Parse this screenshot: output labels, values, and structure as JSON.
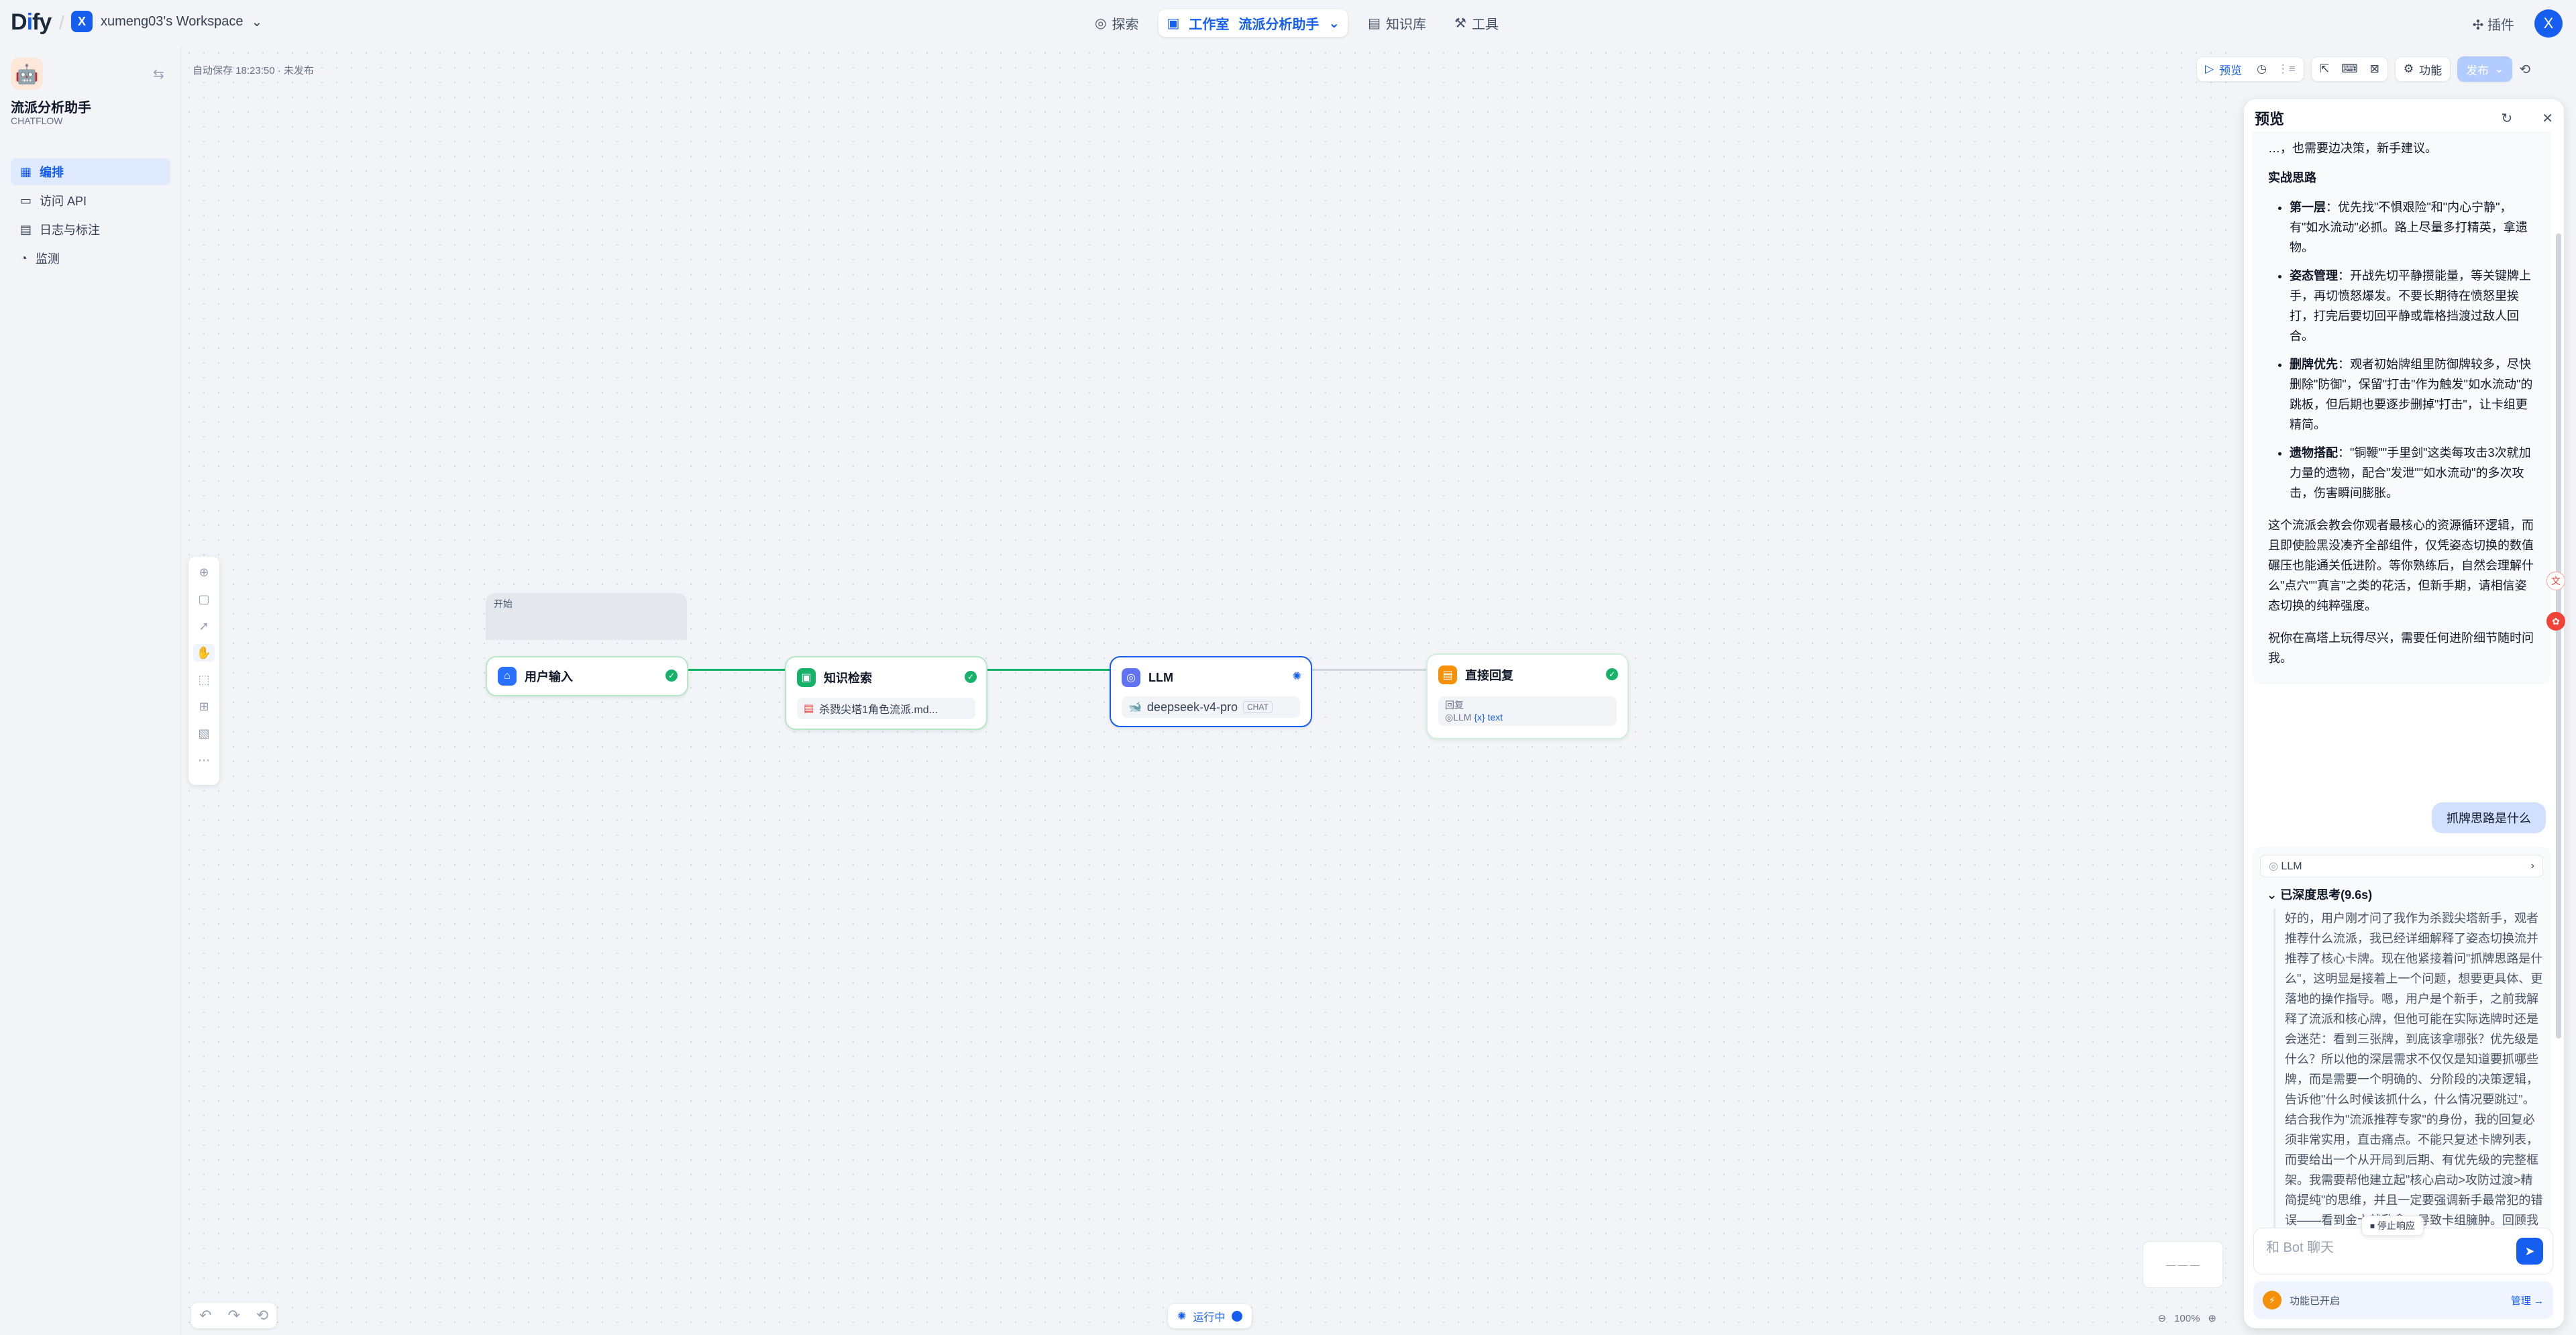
{
  "topbar": {
    "logo": "Dify",
    "workspace_initial": "X",
    "workspace_name": "xumeng03's Workspace",
    "nav": [
      "探索",
      "工作室",
      "流派分析助手",
      "知识库",
      "工具"
    ],
    "plugins": "插件",
    "user_initial": "X"
  },
  "sidebar": {
    "app_name": "流派分析助手",
    "app_type": "CHATFLOW",
    "items": [
      "编排",
      "访问 API",
      "日志与标注",
      "监测"
    ]
  },
  "canvas": {
    "autosave": "自动保存 18:23:50 · 未发布",
    "buttons": {
      "preview": "预览",
      "features": "功能",
      "publish": "发布"
    },
    "status_pill": "运行中",
    "zoom": "100%"
  },
  "nodes": {
    "start_tag": "开始",
    "user_input": "用户输入",
    "knowledge": "知识检索",
    "knowledge_file": "杀戮尖塔1角色流派.md...",
    "llm": "LLM",
    "llm_model": "deepseek-v4-pro",
    "llm_mode": "CHAT",
    "reply": "直接回复",
    "reply_label": "回复",
    "reply_var_node": "LLM",
    "reply_var": "{x} text"
  },
  "preview": {
    "title": "预览",
    "bot_answer": {
      "top_cut": "…，也需要边决策，新手建议。",
      "heading": "实战思路",
      "items": [
        {
          "b": "第一层",
          "t": "：优先找\"不惧艰险\"和\"内心宁静\"，有\"如水流动\"必抓。路上尽量多打精英，拿遗物。"
        },
        {
          "b": "姿态管理",
          "t": "：开战先切平静攒能量，等关键牌上手，再切愤怒爆发。不要长期待在愤怒里挨打，打完后要切回平静或靠格挡渡过敌人回合。"
        },
        {
          "b": "删牌优先",
          "t": "：观者初始牌组里防御牌较多，尽快删除\"防御\"，保留\"打击\"作为触发\"如水流动\"的跳板，但后期也要逐步删掉\"打击\"，让卡组更精简。"
        },
        {
          "b": "遗物搭配",
          "t": "：\"铜鞭\"\"手里剑\"这类每攻击3次就加力量的遗物，配合\"发泄\"\"如水流动\"的多次攻击，伤害瞬间膨胀。"
        }
      ],
      "para1": "这个流派会教会你观者最核心的资源循环逻辑，而且即使脸黑没凑齐全部组件，仅凭姿态切换的数值碾压也能通关低进阶。等你熟练后，自然会理解什么\"点穴\"\"真言\"之类的花活，但新手期，请相信姿态切换的纯粹强度。",
      "para2": "祝你在高塔上玩得尽兴，需要任何进阶细节随时问我。"
    },
    "user_question": "抓牌思路是什么",
    "llm_label": "LLM",
    "thinking_title": "已深度思考(9.6s)",
    "thinking": "好的，用户刚才问了我作为杀戮尖塔新手，观者推荐什么流派，我已经详细解释了姿态切换流并推荐了核心卡牌。现在他紧接着问\"抓牌思路是什么\"，这明显是接着上一个问题，想要更具体、更落地的操作指导。嗯，用户是个新手，之前我解释了流派和核心牌，但他可能在实际选牌时还是会迷茫：看到三张牌，到底该拿哪张？优先级是什么？所以他的深层需求不仅仅是知道要抓哪些牌，而是需要一个明确的、分阶段的决策逻辑，告诉他\"什么时候该抓什么，什么情况要跳过\"。结合我作为\"流派推荐专家\"的身份，我的回复必须非常实用，直击痛点。不能只复述卡牌列表，而要给出一个从开局到后期、有优先级的完整框架。我需要帮他建立起\"核心启动>攻防过渡>精简提纯\"的思维，并且一定要强调新手最常犯的错误——看到金卡就乱拿，导致卡组臃肿。回顾我之前推荐的姿态切换流，里面的卡",
    "stop": "停止响应",
    "input_placeholder": "和 Bot 聊天",
    "feature_bar": "功能已开启",
    "manage": "管理 →"
  }
}
